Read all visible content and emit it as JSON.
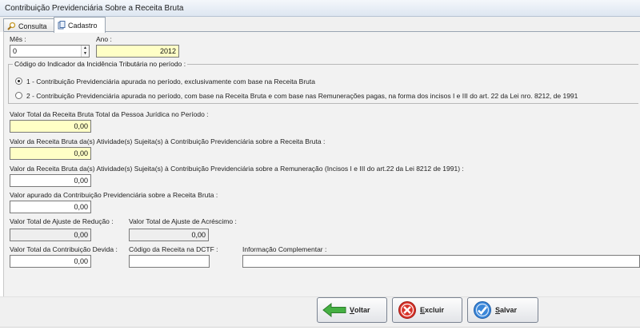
{
  "window": {
    "title": "Contribuição Previdenciária Sobre a Receita Bruta"
  },
  "tabs": [
    {
      "label": "Consulta",
      "icon": "search-icon"
    },
    {
      "label": "Cadastro",
      "icon": "document-icon"
    }
  ],
  "form": {
    "mes": {
      "label": "Mês :",
      "value": "0"
    },
    "ano": {
      "label": "Ano :",
      "value": "2012"
    },
    "indicador": {
      "legend": "Código do Indicador da Incidência Tributária no período :",
      "options": [
        {
          "label": "1 - Contribuição Previdenciária apurada no período, exclusivamente com base na Receita Bruta",
          "checked": true
        },
        {
          "label": "2 - Contribuição Previdenciária apurada no período, com base na Receita Bruta e com base nas Remunerações pagas, na forma dos  incisos I e III do art. 22 da Lei nro. 8212, de 1991",
          "checked": false
        }
      ]
    },
    "valor_total_receita": {
      "label": "Valor Total da Receita Bruta Total da Pessoa Jurídica no Período :",
      "value": "0,00"
    },
    "valor_receita_atividades": {
      "label": "Valor da Receita Bruta da(s) Atividade(s) Sujeita(s) à Contribuição Previdenciária sobre a Receita Bruta :",
      "value": "0,00"
    },
    "valor_receita_remuneracao": {
      "label": "Valor da Receita Bruta da(s) Atividade(s) Sujeita(s) à Contribuição Previdenciária sobre a Remuneração (Incisos I e III do art.22 da Lei 8212 de 1991) :",
      "value": "0,00"
    },
    "valor_apurado": {
      "label": "Valor apurado da Contribuição Previdenciária sobre a Receita Bruta :",
      "value": "0,00"
    },
    "ajuste_reducao": {
      "label": "Valor Total de Ajuste de Redução :",
      "value": "0,00"
    },
    "ajuste_acrescimo": {
      "label": "Valor Total de Ajuste de Acréscimo :",
      "value": "0,00"
    },
    "contribuicao_devida": {
      "label": "Valor Total da Contribuição Devida :",
      "value": "0,00"
    },
    "codigo_receita": {
      "label": "Código da Receita na DCTF :",
      "value": ""
    },
    "info_complementar": {
      "label": "Informação Complementar :",
      "value": ""
    }
  },
  "buttons": {
    "voltar": {
      "label_first": "V",
      "label_rest": "oltar",
      "icon": "arrow-left-icon",
      "color": "#3aa33a"
    },
    "excluir": {
      "label_first": "E",
      "label_rest": "xcluir",
      "icon": "delete-icon",
      "color": "#d9342b"
    },
    "salvar": {
      "label_first": "S",
      "label_rest": "alvar",
      "icon": "check-icon",
      "color": "#2f7fd6"
    }
  }
}
